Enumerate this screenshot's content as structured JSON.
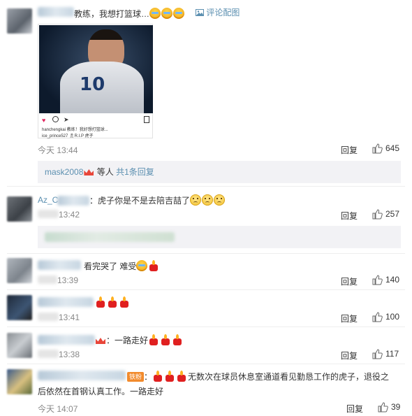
{
  "comments": [
    {
      "text_before": "教练，我想打篮球…",
      "pic_link": "评论配图",
      "image_card": {
        "jersey_number": "10",
        "caption_line1": "hanchengkai 教练！我好想打篮球...",
        "caption_line2": "ice_prince527 🎗R.I.P 虎子"
      },
      "time": "今天 13:44",
      "reply": "回复",
      "likes": "645",
      "sub_replies": {
        "user": "mask2008",
        "text": "等人",
        "count_link": "共1条回复"
      }
    },
    {
      "name_visible": "Az_C",
      "text": "：虎子你是不是去陪吉喆了",
      "time": "13:42",
      "reply": "回复",
      "likes": "257"
    },
    {
      "text": "看完哭了 难受",
      "time": "13:39",
      "reply": "回复",
      "likes": "140"
    },
    {
      "time": "13:41",
      "reply": "回复",
      "likes": "100"
    },
    {
      "text": "：一路走好",
      "time": "13:38",
      "reply": "回复",
      "likes": "117"
    },
    {
      "badge": "铁粉",
      "text_line1": "无数次在球员休息室通道看见勤恳工作的虎子，退役之",
      "text_line2": "后依然在首钢认真工作。一路走好",
      "time": "今天 14:07",
      "reply": "回复",
      "likes": "39"
    }
  ],
  "colors": {
    "link": "#5b8fb0",
    "muted": "#888888",
    "sub_bg": "#f2f2f5"
  },
  "icons": [
    "thumbs-up-icon",
    "picture-icon",
    "crying-emoji",
    "candle-emoji",
    "sad-emoji",
    "crown-icon"
  ]
}
